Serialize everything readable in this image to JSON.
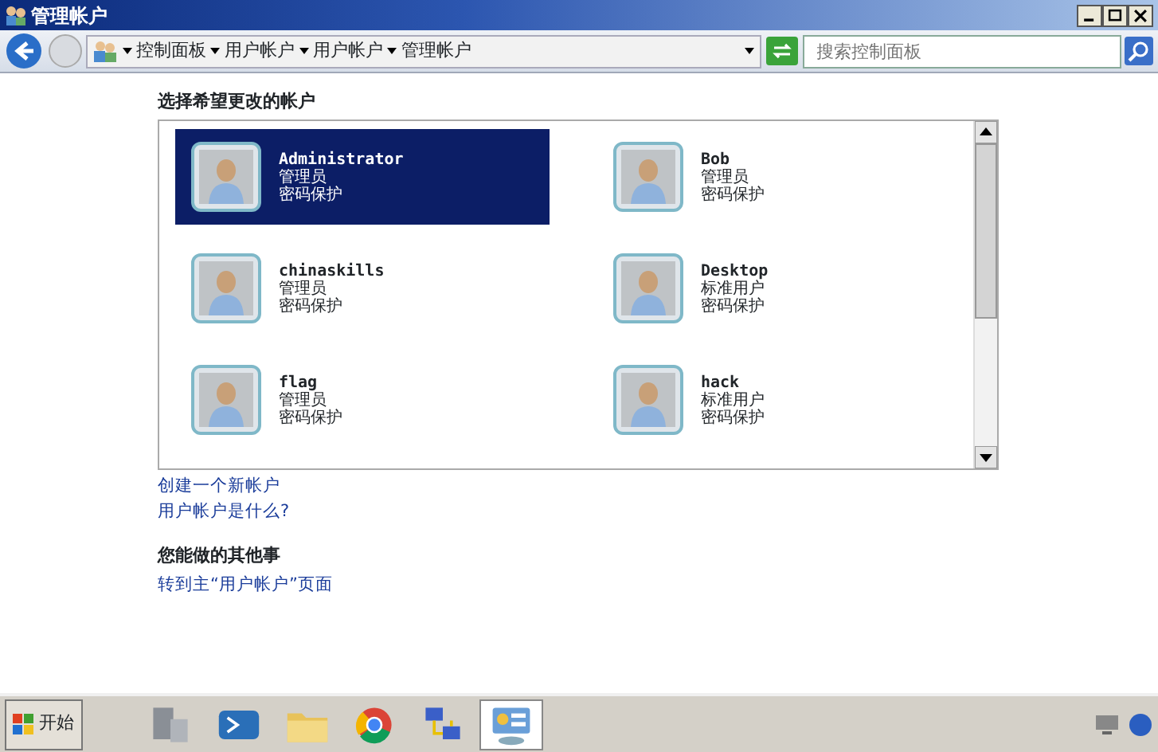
{
  "window": {
    "title": "管理帐户"
  },
  "address_bar": {
    "breadcrumbs": [
      "控制面板",
      "用户帐户",
      "用户帐户",
      "管理帐户"
    ],
    "search": {
      "placeholder": "搜索控制面板"
    }
  },
  "heading": "选择希望更改的帐户",
  "accounts": [
    {
      "name": "Administrator",
      "type": "管理员",
      "protection": "密码保护",
      "selected": true
    },
    {
      "name": "Bob",
      "type": "管理员",
      "protection": "密码保护",
      "selected": false
    },
    {
      "name": "chinaskills",
      "type": "管理员",
      "protection": "密码保护",
      "selected": false
    },
    {
      "name": "Desktop",
      "type": "标准用户",
      "protection": "密码保护",
      "selected": false
    },
    {
      "name": "flag",
      "type": "管理员",
      "protection": "密码保护",
      "selected": false
    },
    {
      "name": "hack",
      "type": "标准用户",
      "protection": "密码保护",
      "selected": false
    }
  ],
  "links": [
    "创建一个新帐户",
    "用户帐户是什么?"
  ],
  "other_heading": "您能做的其他事",
  "other_links": [
    "转到主“用户帐户”页面"
  ],
  "taskbar": {
    "start": "开始",
    "apps": [
      {
        "kind": "server",
        "selected": false
      },
      {
        "kind": "shell",
        "selected": false
      },
      {
        "kind": "folder",
        "selected": false
      },
      {
        "kind": "browser",
        "selected": false
      },
      {
        "kind": "network",
        "selected": false
      },
      {
        "kind": "panel",
        "selected": true
      }
    ]
  }
}
